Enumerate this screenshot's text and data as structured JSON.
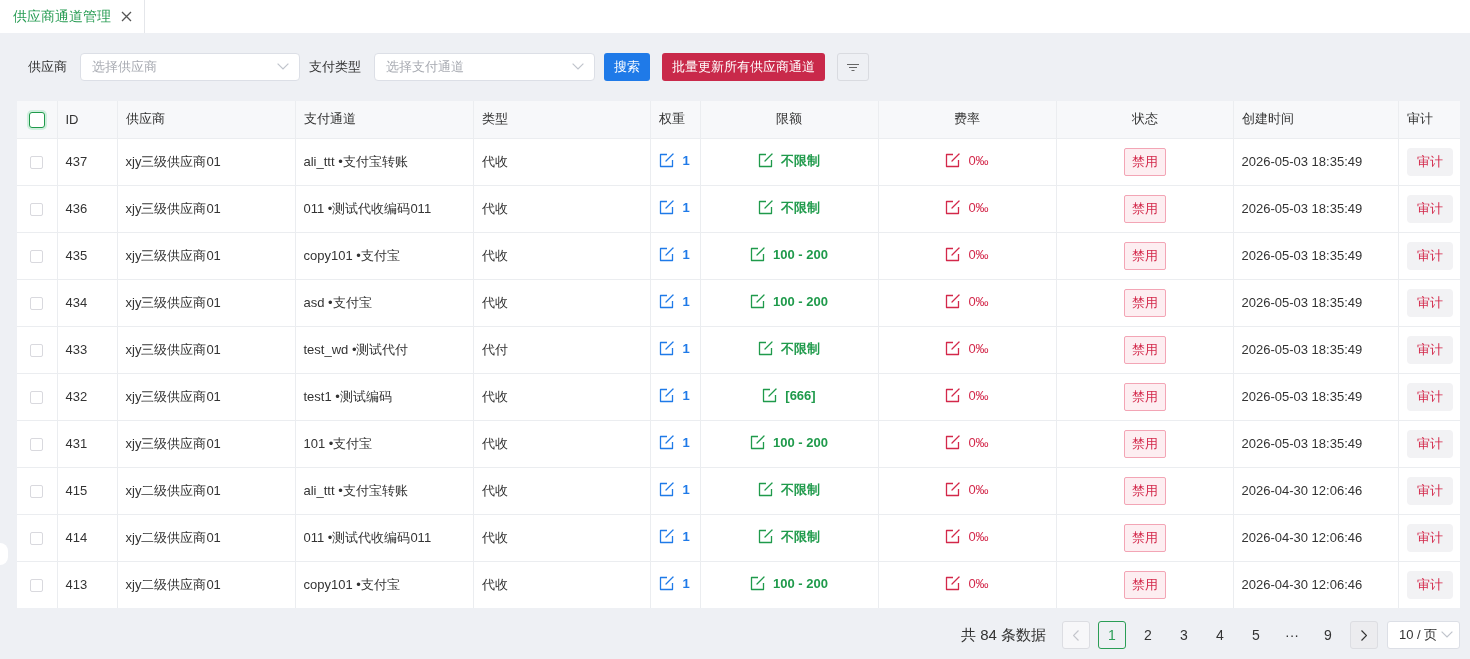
{
  "tabs": [
    {
      "title": "供应商通道管理",
      "selected": true
    }
  ],
  "filters": {
    "fields": [
      {
        "label": "供应商",
        "placeholder": "选择供应商"
      },
      {
        "label": "支付类型",
        "placeholder": "选择支付通道"
      }
    ],
    "search_button": "搜索",
    "batch_button": "批量更新所有供应商通道"
  },
  "table": {
    "header_checkbox": {
      "checked": false
    },
    "columns": [
      "ID",
      "供应商",
      "支付通道",
      "类型",
      "权重",
      "限额",
      "费率",
      "状态",
      "创建时间",
      "审计"
    ],
    "rows": [
      {
        "checked": false,
        "id": "437",
        "supplier": "xjy三级供应商01",
        "channel": "ali_ttt •支付宝转账",
        "type": "代收",
        "weight": "1",
        "limit": "不限制",
        "rate": "0‰",
        "status": "禁用",
        "created": "2026-05-03 18:35:49",
        "action": "审计"
      },
      {
        "checked": false,
        "id": "436",
        "supplier": "xjy三级供应商01",
        "channel": "011 •测试代收编码011",
        "type": "代收",
        "weight": "1",
        "limit": "不限制",
        "rate": "0‰",
        "status": "禁用",
        "created": "2026-05-03 18:35:49",
        "action": "审计"
      },
      {
        "checked": false,
        "id": "435",
        "supplier": "xjy三级供应商01",
        "channel": "copy101 •支付宝",
        "type": "代收",
        "weight": "1",
        "limit": "100 - 200",
        "rate": "0‰",
        "status": "禁用",
        "created": "2026-05-03 18:35:49",
        "action": "审计"
      },
      {
        "checked": false,
        "id": "434",
        "supplier": "xjy三级供应商01",
        "channel": "asd •支付宝",
        "type": "代收",
        "weight": "1",
        "limit": "100 - 200",
        "rate": "0‰",
        "status": "禁用",
        "created": "2026-05-03 18:35:49",
        "action": "审计"
      },
      {
        "checked": false,
        "id": "433",
        "supplier": "xjy三级供应商01",
        "channel": "test_wd •测试代付",
        "type": "代付",
        "weight": "1",
        "limit": "不限制",
        "rate": "0‰",
        "status": "禁用",
        "created": "2026-05-03 18:35:49",
        "action": "审计"
      },
      {
        "checked": false,
        "id": "432",
        "supplier": "xjy三级供应商01",
        "channel": "test1 •测试编码",
        "type": "代收",
        "weight": "1",
        "limit": "[666]",
        "rate": "0‰",
        "status": "禁用",
        "created": "2026-05-03 18:35:49",
        "action": "审计"
      },
      {
        "checked": false,
        "id": "431",
        "supplier": "xjy三级供应商01",
        "channel": "101 •支付宝",
        "type": "代收",
        "weight": "1",
        "limit": "100 - 200",
        "rate": "0‰",
        "status": "禁用",
        "created": "2026-05-03 18:35:49",
        "action": "审计"
      },
      {
        "checked": false,
        "id": "415",
        "supplier": "xjy二级供应商01",
        "channel": "ali_ttt •支付宝转账",
        "type": "代收",
        "weight": "1",
        "limit": "不限制",
        "rate": "0‰",
        "status": "禁用",
        "created": "2026-04-30 12:06:46",
        "action": "审计"
      },
      {
        "checked": false,
        "id": "414",
        "supplier": "xjy二级供应商01",
        "channel": "011 •测试代收编码011",
        "type": "代收",
        "weight": "1",
        "limit": "不限制",
        "rate": "0‰",
        "status": "禁用",
        "created": "2026-04-30 12:06:46",
        "action": "审计"
      },
      {
        "checked": false,
        "id": "413",
        "supplier": "xjy二级供应商01",
        "channel": "copy101 •支付宝",
        "type": "代收",
        "weight": "1",
        "limit": "100 - 200",
        "rate": "0‰",
        "status": "禁用",
        "created": "2026-04-30 12:06:46",
        "action": "审计"
      }
    ]
  },
  "pagination": {
    "total": "共 84 条数据",
    "prev": {
      "disabled": true
    },
    "next": {
      "disabled": false
    },
    "pages": [
      {
        "label": "1",
        "selected": true
      },
      {
        "label": "2",
        "selected": false
      },
      {
        "label": "3",
        "selected": false
      },
      {
        "label": "4",
        "selected": false
      },
      {
        "label": "5",
        "selected": false
      },
      {
        "label": "···",
        "selected": false
      },
      {
        "label": "9",
        "selected": false
      }
    ],
    "page_size": "10 / 页"
  }
}
